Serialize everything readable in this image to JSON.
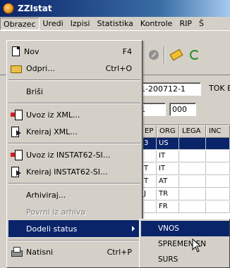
{
  "window": {
    "title": "ZZIstat"
  },
  "menubar": {
    "items": [
      {
        "label": "Obrazec"
      },
      {
        "label": "Uredi"
      },
      {
        "label": "Izpisi"
      },
      {
        "label": "Statistika"
      },
      {
        "label": "Kontrole"
      },
      {
        "label": "RIP"
      },
      {
        "label": "Š"
      }
    ]
  },
  "form": {
    "doc_number": "1-200712-1",
    "tok_label": "TOK E",
    "field1": "1",
    "field2": "000"
  },
  "grid": {
    "headers": [
      "EP",
      "ORG",
      "LEGA",
      "INC"
    ],
    "rows": [
      [
        "3",
        "US",
        "",
        ""
      ],
      [
        "",
        "IT",
        "",
        ""
      ],
      [
        "T",
        "IT",
        "",
        ""
      ],
      [
        "T",
        "AT",
        "",
        ""
      ],
      [
        "J",
        "TR",
        "",
        ""
      ],
      [
        "",
        "FR",
        "",
        ""
      ]
    ]
  },
  "file_menu": {
    "items": [
      {
        "label": "Nov",
        "shortcut": "F4",
        "icon": "new-document-icon"
      },
      {
        "label": "Odpri...",
        "shortcut": "Ctrl+O",
        "icon": "open-folder-icon"
      },
      {
        "label": "Briši",
        "shortcut": ""
      },
      {
        "label": "Uvoz iz XML...",
        "shortcut": "",
        "icon": "import-icon"
      },
      {
        "label": "Kreiraj XML...",
        "shortcut": "",
        "icon": "export-icon"
      },
      {
        "label": "Uvoz iz INSTAT62-SI...",
        "shortcut": "",
        "icon": "import-icon"
      },
      {
        "label": "Kreiraj INSTAT62-SI...",
        "shortcut": "",
        "icon": "export-icon"
      },
      {
        "label": "Arhiviraj...",
        "shortcut": ""
      },
      {
        "label": "Povrni iz arhiva",
        "shortcut": "",
        "disabled": true
      },
      {
        "label": "Dodeli status",
        "shortcut": "",
        "submenu": true
      },
      {
        "label": "Natisni",
        "shortcut": "Ctrl+P",
        "icon": "printer-icon"
      }
    ]
  },
  "status_submenu": {
    "items": [
      {
        "label": "VNOS"
      },
      {
        "label": "SPREMENJEN"
      },
      {
        "label": "SURS"
      }
    ]
  }
}
